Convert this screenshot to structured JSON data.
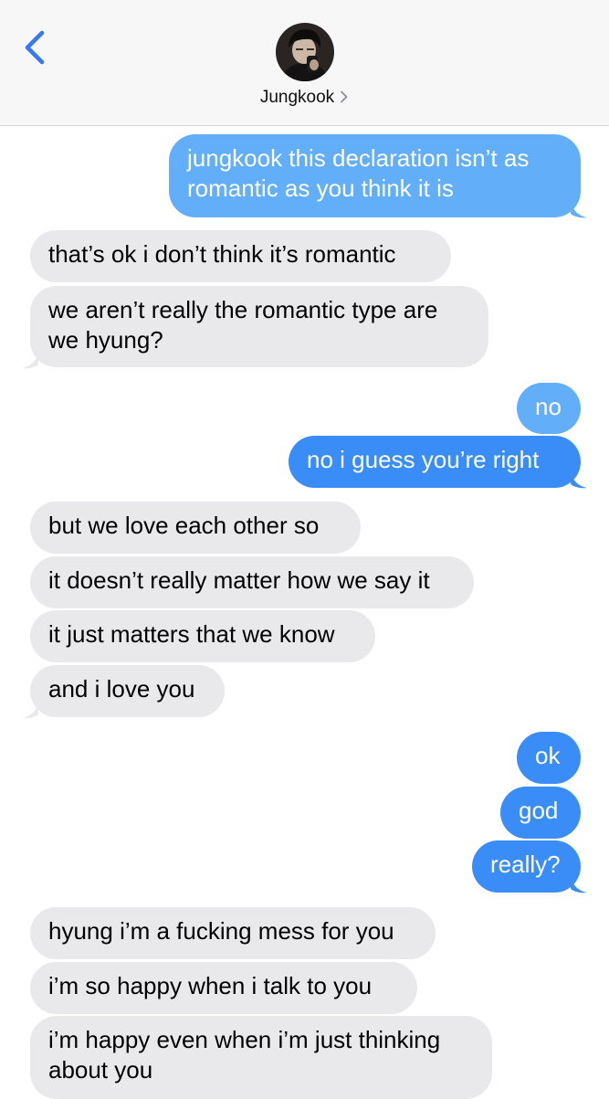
{
  "header": {
    "back_icon": "chevron-left-icon",
    "contact_name": "Jungkook",
    "contact_chevron": "chevron-right-icon",
    "avatar": "contact-avatar-photo"
  },
  "colors": {
    "sent_bubble": "#3a8df7",
    "sent_bubble_top": "#62aef8",
    "received_bubble": "#e9e9eb",
    "accent": "#3478f6"
  },
  "messages": [
    {
      "from": "me",
      "text": "jungkook this declaration isn’t as romantic as you think it is"
    },
    {
      "from": "them",
      "text": "that’s ok i don’t think it’s romantic"
    },
    {
      "from": "them",
      "text": "we aren’t really the romantic type are we hyung?"
    },
    {
      "from": "me",
      "text": "no"
    },
    {
      "from": "me",
      "text": "no i guess you’re right"
    },
    {
      "from": "them",
      "text": "but we love each other so"
    },
    {
      "from": "them",
      "text": "it doesn’t really matter how we say it"
    },
    {
      "from": "them",
      "text": "it just matters that we know"
    },
    {
      "from": "them",
      "text": "and i love you"
    },
    {
      "from": "me",
      "text": "ok"
    },
    {
      "from": "me",
      "text": "god"
    },
    {
      "from": "me",
      "text": "really?"
    },
    {
      "from": "them",
      "text": "hyung i’m a fucking mess for you"
    },
    {
      "from": "them",
      "text": "i’m so happy when i talk to you"
    },
    {
      "from": "them",
      "text": "i’m happy even when i’m just thinking about you"
    }
  ]
}
